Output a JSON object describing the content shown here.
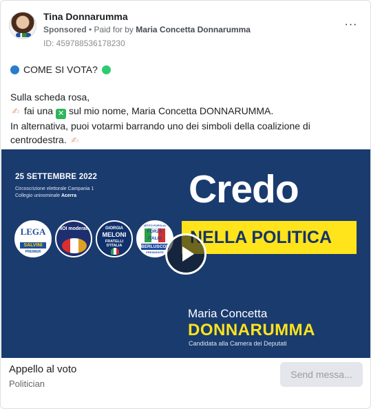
{
  "header": {
    "page_name": "Tina Donnarumma",
    "sponsored_label": "Sponsored",
    "separator": " • ",
    "paid_for_label": "Paid for by ",
    "payer_name": "Maria Concetta Donnarumma",
    "ad_id": "ID: 459788536178230",
    "more_icon": "more-horizontal-icon"
  },
  "body": {
    "line1": "COME SI VOTA?",
    "line2": "Sulla scheda rosa,",
    "line3_a": "fai una",
    "line3_b": "sul mio nome, Maria Concetta DONNARUMMA.",
    "line4": "In alternativa, puoi votarmi barrando uno dei simboli della coalizione di centrodestra.",
    "icons": {
      "blue_circle": "blue-circle-icon",
      "green_circle": "green-circle-icon",
      "writing_hand": "writing-hand-icon",
      "cross_mark": "cross-mark-button-icon"
    },
    "cross_glyph": "✕",
    "hand_glyph": "✍"
  },
  "media": {
    "date": "25 SETTEMBRE 2022",
    "circ_line1": "Circoscrizione elettorale Campania 1",
    "circ_line2_prefix": "Collegio uninominale ",
    "circ_line2_bold": "Acerra",
    "headline": "Credo",
    "subheadline": "NELLA POLITICA",
    "candidate_first": "Maria Concetta",
    "candidate_last": "DONNARUMMA",
    "candidate_role": "Candidata alla Camera dei Deputati",
    "logos": {
      "lega": {
        "t1": "LEGA",
        "t2": "SALVINI",
        "t3": "PREMIER"
      },
      "noi": {
        "t1": "NOI moderati"
      },
      "fdi": {
        "t1": "GIORGIA",
        "t2": "MELONI",
        "t3": "FRATELLI D'ITALIA"
      },
      "fi": {
        "t0": "PARTITO POPOLARE EUROPEO",
        "t1": "FORZA ITALIA",
        "t2": "BERLUSCONI",
        "t3": "PRESIDENTE"
      }
    },
    "colors": {
      "background": "#1a3b6e",
      "accent_yellow": "#ffe41c"
    }
  },
  "footer": {
    "title": "Appello al voto",
    "category": "Politician",
    "send_button": "Send messa..."
  }
}
